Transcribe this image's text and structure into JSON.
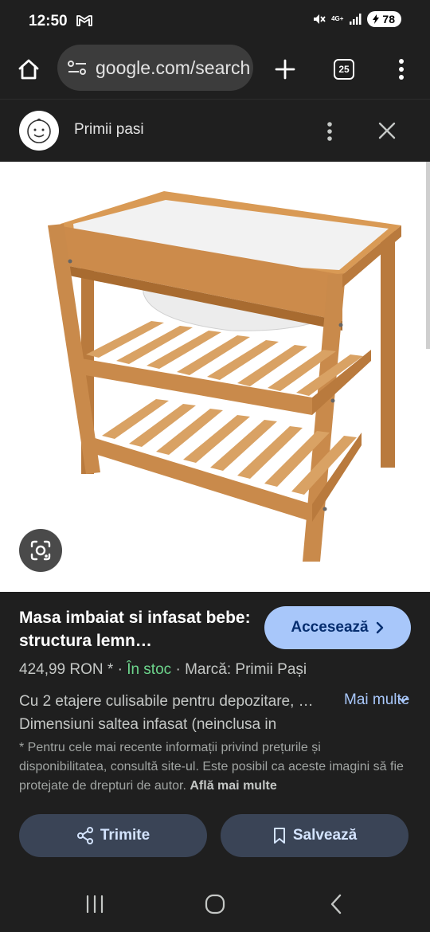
{
  "status_bar": {
    "time": "12:50",
    "network": "4G+",
    "battery": "78",
    "icons": [
      "gmail-icon",
      "mute-icon",
      "signal-icon",
      "battery-icon"
    ]
  },
  "toolbar": {
    "url": "google.com/search",
    "tab_count": "25",
    "icons": [
      "home-icon",
      "site-info-icon",
      "plus-icon",
      "tabs-icon",
      "more-vert-icon"
    ]
  },
  "source": {
    "name": "Primii pasi",
    "icons": [
      "baby-face-logo",
      "more-vert-icon",
      "close-icon"
    ]
  },
  "image": {
    "alt": "Masa imbaiat si infasat bebe: structura lemn",
    "icons": [
      "google-lens-icon"
    ]
  },
  "product": {
    "title": "Masa imbaiat si infasat bebe: structura lemn…",
    "visit_label": "Accesează",
    "price": "424,99 RON *",
    "separator": "·",
    "stock": "În stoc",
    "brand": "Marcă: Primii Pași",
    "desc_line1": "Cu 2 etajere culisabile pentru depozitare, …",
    "desc_line2": "Dimensiuni saltea infasat (neinclusa in",
    "more_label": "Mai multe",
    "disclaimer": "* Pentru cele mai recente informații privind prețurile și disponibilitatea, consultă site-ul. Este posibil ca aceste imagini să fie protejate de drepturi de autor.",
    "learn_more": "Află mai multe",
    "share_label": "Trimite",
    "save_label": "Salvează"
  },
  "colors": {
    "background": "#1f1f1f",
    "accent": "#a8c7fa",
    "stock_green": "#6dd58c",
    "action_button": "#3a4456",
    "wood": "#c98a4b"
  },
  "navbar": {
    "icons": [
      "recents-icon",
      "home-circle-icon",
      "back-icon"
    ]
  }
}
